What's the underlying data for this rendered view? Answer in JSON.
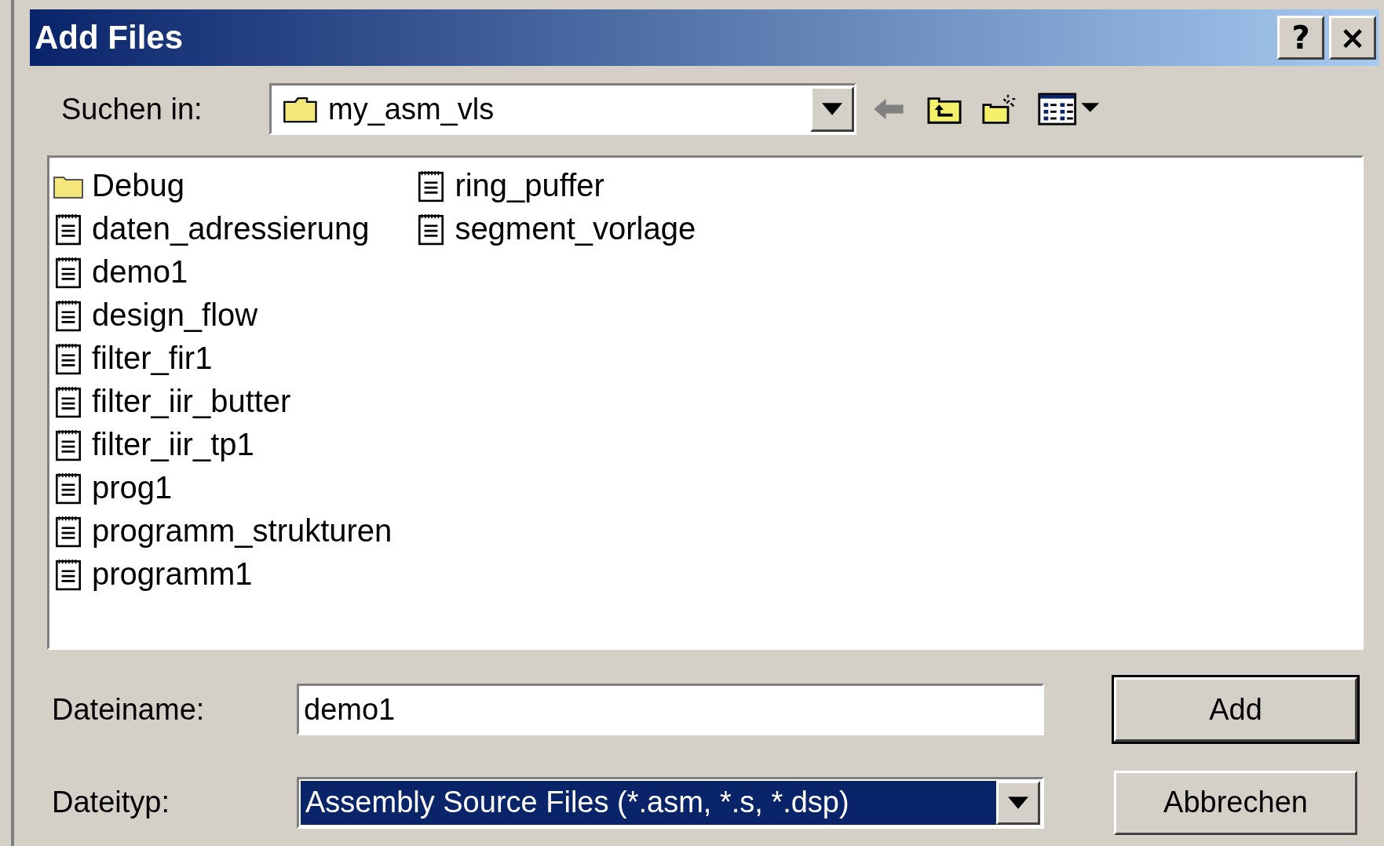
{
  "window": {
    "title": "Add Files",
    "controls": [
      "?",
      "×"
    ]
  },
  "look_in": {
    "label": "Suchen in:",
    "value": "my_asm_vls"
  },
  "files": [
    {
      "name": "Debug",
      "kind": "folder"
    },
    {
      "name": "daten_adressierung",
      "kind": "file"
    },
    {
      "name": "demo1",
      "kind": "file"
    },
    {
      "name": "design_flow",
      "kind": "file"
    },
    {
      "name": "filter_fir1",
      "kind": "file"
    },
    {
      "name": "filter_iir_butter",
      "kind": "file"
    },
    {
      "name": "filter_iir_tp1",
      "kind": "file"
    },
    {
      "name": "prog1",
      "kind": "file"
    },
    {
      "name": "programm_strukturen",
      "kind": "file"
    },
    {
      "name": "programm1",
      "kind": "file"
    },
    {
      "name": "ring_puffer",
      "kind": "file"
    },
    {
      "name": "segment_vorlage",
      "kind": "file"
    }
  ],
  "file_name": {
    "label": "Dateiname:",
    "value": "demo1"
  },
  "file_type": {
    "label": "Dateityp:",
    "value": "Assembly Source Files (*.asm, *.s, *.dsp)"
  },
  "buttons": [
    {
      "label": "Add",
      "default": true
    },
    {
      "label": "Abbrechen",
      "default": false
    }
  ]
}
